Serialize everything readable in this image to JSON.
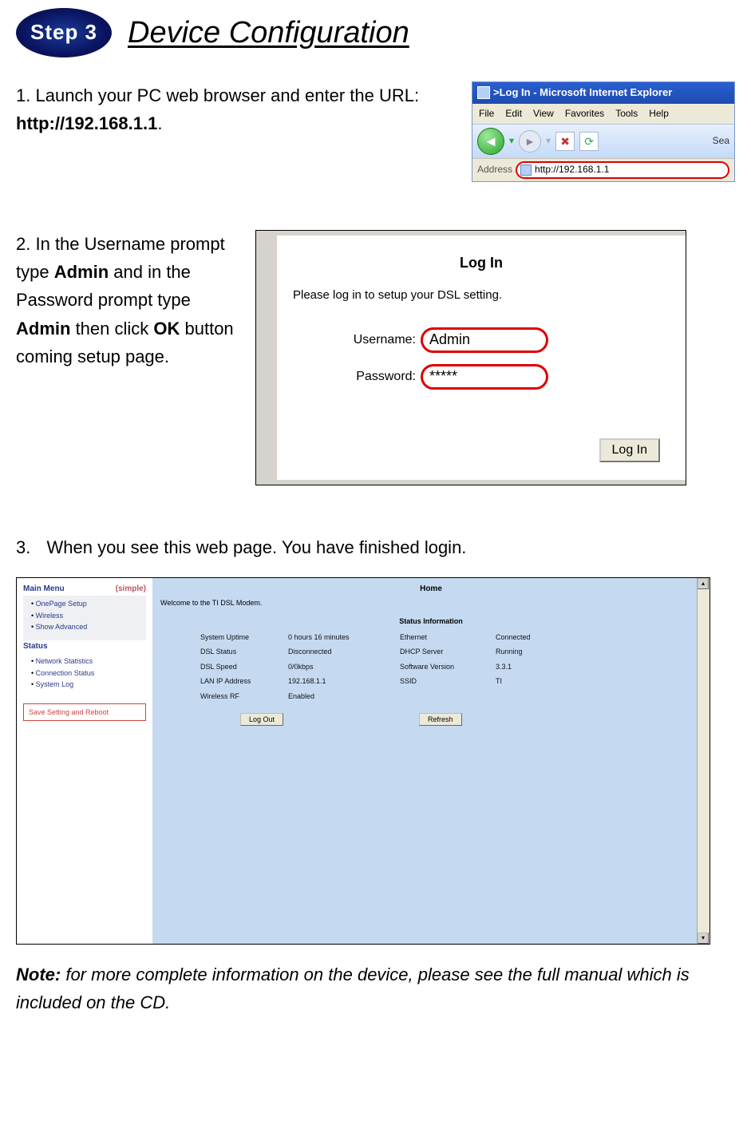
{
  "heading": {
    "badge": "Step 3",
    "title": " Device Configuration"
  },
  "step1": {
    "num": "1.",
    "text_a": "Launch your PC web browser and enter the URL: ",
    "text_b_bold": "http://192.168.1.1",
    "text_c": "."
  },
  "ie": {
    "title": ">Log In - Microsoft Internet Explorer",
    "menu": {
      "file": "File",
      "edit": "Edit",
      "view": "View",
      "fav": "Favorites",
      "tools": "Tools",
      "help": "Help"
    },
    "sea": "Sea",
    "addr_label": "Address",
    "addr_value": "http://192.168.1.1"
  },
  "step2": {
    "num": "2.",
    "text_a": "In the Username prompt type ",
    "bold1": "Admin",
    "text_b": " and in the Password prompt type ",
    "bold2": "Admin",
    "text_c": " then click ",
    "bold3": "OK",
    "text_d": " button coming setup page."
  },
  "login": {
    "title": "Log In",
    "sub": "Please log in to setup your DSL setting.",
    "user_lbl": "Username:",
    "user_val": "Admin",
    "pass_lbl": "Password:",
    "pass_val": "*****",
    "btn": "Log In"
  },
  "step3": {
    "num": "3.",
    "text": "When you see this web page. You have finished login."
  },
  "homepage": {
    "side_main": "Main Menu",
    "simple": "(simple)",
    "menu_items": [
      "OnePage Setup",
      "Wireless",
      "Show Advanced"
    ],
    "status_h": "Status",
    "status_items": [
      "Network Statistics",
      "Connection Status",
      "System Log"
    ],
    "save_btn": "Save Setting and Reboot",
    "home": "Home",
    "welcome": "Welcome to the TI DSL Modem.",
    "si": "Status Information",
    "rows": [
      [
        "System Uptime",
        "0 hours 16 minutes",
        "Ethernet",
        "Connected"
      ],
      [
        "DSL Status",
        "Disconnected",
        "DHCP Server",
        "Running"
      ],
      [
        "DSL Speed",
        "0/0kbps",
        "Software Version",
        "3.3.1"
      ],
      [
        "LAN IP Address",
        "192.168.1.1",
        "SSID",
        "TI"
      ],
      [
        "Wireless RF",
        "Enabled",
        "",
        ""
      ]
    ],
    "logout": "Log Out",
    "refresh": "Refresh"
  },
  "note": {
    "label": "Note:",
    "text": " for more complete information on the device, please see the full manual which is included on the CD."
  }
}
